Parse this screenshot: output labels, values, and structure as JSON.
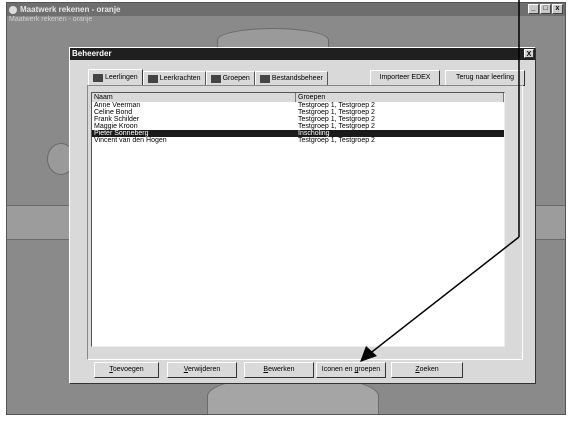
{
  "app": {
    "title": "Maatwerk rekenen - oranje",
    "subtitle": "Maatwerk rekenen - oranje",
    "min_label": "_",
    "max_label": "□",
    "close_label": "x"
  },
  "dialog": {
    "title": "Beheerder",
    "close_label": "X",
    "tabs": [
      {
        "label": "Leerlingen",
        "icon": "students-icon"
      },
      {
        "label": "Leerkrachten",
        "icon": "teachers-icon"
      },
      {
        "label": "Groepen",
        "icon": "groups-icon"
      },
      {
        "label": "Bestandsbeheer",
        "icon": "file-management-icon"
      }
    ],
    "import_button": "Importeer EDEX",
    "back_button": "Terug naar leerling",
    "list": {
      "headers": [
        "Naam",
        "Groepen"
      ],
      "rows": [
        {
          "name": "Anne Veerman",
          "groups": "Testgroep 1, Testgroep 2"
        },
        {
          "name": "Celine Bond",
          "groups": "Testgroep 1, Testgroep 2"
        },
        {
          "name": "Frank Schilder",
          "groups": "Testgroep 1, Testgroep 2"
        },
        {
          "name": "Maggie Kroon",
          "groups": "Testgroep 1, Testgroep 2"
        },
        {
          "name": "Pieter Sonneberg",
          "groups": "Inscholing",
          "selected": true
        },
        {
          "name": "Vincent van den Hogen",
          "groups": "Testgroep 1, Testgroep 2"
        }
      ]
    },
    "buttons": {
      "add": {
        "prefix": "",
        "key": "T",
        "rest": "oevoegen"
      },
      "remove": {
        "prefix": "",
        "key": "V",
        "rest": "erwijderen"
      },
      "edit": {
        "prefix": "",
        "key": "B",
        "rest": "ewerken"
      },
      "icons": {
        "prefix": "Iconen en ",
        "key": "g",
        "rest": "roepen"
      },
      "search": {
        "prefix": "",
        "key": "Z",
        "rest": "oeken"
      }
    }
  }
}
